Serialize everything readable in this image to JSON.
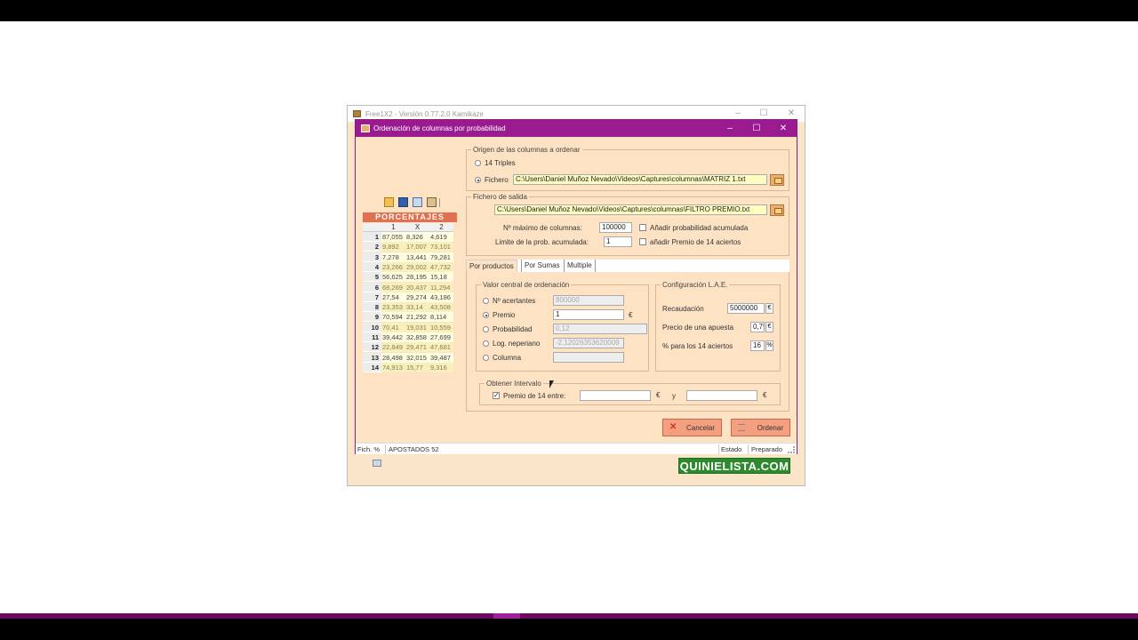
{
  "main_window": {
    "title": "Free1X2 - Versión 0.77.2.0 Kamikaze",
    "logo_text": "QUINIELISTA.COM",
    "controls": {
      "minimize": "–",
      "maximize": "☐",
      "close": "✕"
    }
  },
  "dialog": {
    "title": "Ordenación de columnas por probabilidad",
    "controls": {
      "minimize": "–",
      "maximize": "☐",
      "close": "✕"
    }
  },
  "porcentajes": {
    "title": "PORCENTAJES",
    "headers": [
      "1",
      "X",
      "2"
    ],
    "rows": [
      {
        "n": "1",
        "v": [
          "87,055",
          "8,326",
          "4,619"
        ]
      },
      {
        "n": "2",
        "v": [
          "9,892",
          "17,007",
          "73,101"
        ]
      },
      {
        "n": "3",
        "v": [
          "7,278",
          "13,441",
          "79,281"
        ]
      },
      {
        "n": "4",
        "v": [
          "23,266",
          "29,002",
          "47,732"
        ]
      },
      {
        "n": "5",
        "v": [
          "56,625",
          "28,195",
          "15,18"
        ]
      },
      {
        "n": "6",
        "v": [
          "68,269",
          "20,437",
          "11,294"
        ]
      },
      {
        "n": "7",
        "v": [
          "27,54",
          "29,274",
          "43,186"
        ]
      },
      {
        "n": "8",
        "v": [
          "23,353",
          "33,14",
          "43,508"
        ]
      },
      {
        "n": "9",
        "v": [
          "70,594",
          "21,292",
          "8,114"
        ]
      },
      {
        "n": "10",
        "v": [
          "70,41",
          "19,031",
          "10,559"
        ]
      },
      {
        "n": "11",
        "v": [
          "39,442",
          "32,858",
          "27,699"
        ]
      },
      {
        "n": "12",
        "v": [
          "22,849",
          "29,471",
          "47,681"
        ]
      },
      {
        "n": "13",
        "v": [
          "28,498",
          "32,015",
          "39,487"
        ]
      },
      {
        "n": "14",
        "v": [
          "74,913",
          "15,77",
          "9,316"
        ]
      }
    ]
  },
  "origen": {
    "label": "Origen de las columnas a ordenar",
    "option_triples": "14 Triples",
    "option_fichero": "Fichero",
    "fichero_path": "C:\\Users\\Daniel Muñoz Nevado\\Videos\\Captures\\columnas\\MATRIZ 1.txt"
  },
  "salida": {
    "label": "Fichero de salida",
    "path": "C:\\Users\\Daniel Muñoz Nevado\\Videos\\Captures\\columnas\\FILTRO PREMIO.txt",
    "max_cols_label": "Nº máximo de columnas:",
    "max_cols_value": "100000",
    "limite_label": "Limite de la prob. acumulada:",
    "limite_value": "1",
    "add_prob_label": "Añadir probabilidad acumulada",
    "add_premio_label": "añadir Premio de 14 aciertos"
  },
  "tabs": [
    "Por productos",
    "Por Sumas",
    "Multiple"
  ],
  "valor_central": {
    "label": "Valor central de ordenación",
    "options": [
      {
        "label": "Nº acertantes",
        "value": "800000",
        "selected": false,
        "enabled": false
      },
      {
        "label": "Premio",
        "value": "1",
        "selected": true,
        "enabled": true,
        "unit": "€"
      },
      {
        "label": "Probabilidad",
        "value": "0,12",
        "selected": false,
        "enabled": false
      },
      {
        "label": "Log. neperiano",
        "value": "-2,12026353620009",
        "selected": false,
        "enabled": false
      },
      {
        "label": "Columna",
        "value": "",
        "selected": false,
        "enabled": false
      }
    ]
  },
  "config_lae": {
    "label": "Configuración L.A.E.",
    "recaudacion_label": "Recaudación",
    "recaudacion_value": "5000000",
    "recaudacion_unit": "€",
    "precio_label": "Precio de una apuesta",
    "precio_value": "0,75",
    "precio_unit": "€",
    "porcentaje_label": "% para los 14 aciertos",
    "porcentaje_value": "16",
    "porcentaje_unit": "%"
  },
  "intervalo": {
    "label": "Obtener Intervalo",
    "premio_label": "Premio de 14 entre:",
    "from_value": "",
    "to_value": "",
    "unit": "€",
    "and_label": "y"
  },
  "buttons": {
    "cancel": "Cancelar",
    "order": "Ordenar"
  },
  "status": {
    "fich": "Fich. %",
    "apostados": "APOSTADOS 52",
    "estado_label": "Estado",
    "estado_value": "Preparado"
  },
  "icons": [
    "folder-open-icon",
    "save-icon",
    "copy-icon",
    "paste-icon",
    "mail-icon",
    "cancel-x-icon",
    "order-lines-icon"
  ]
}
